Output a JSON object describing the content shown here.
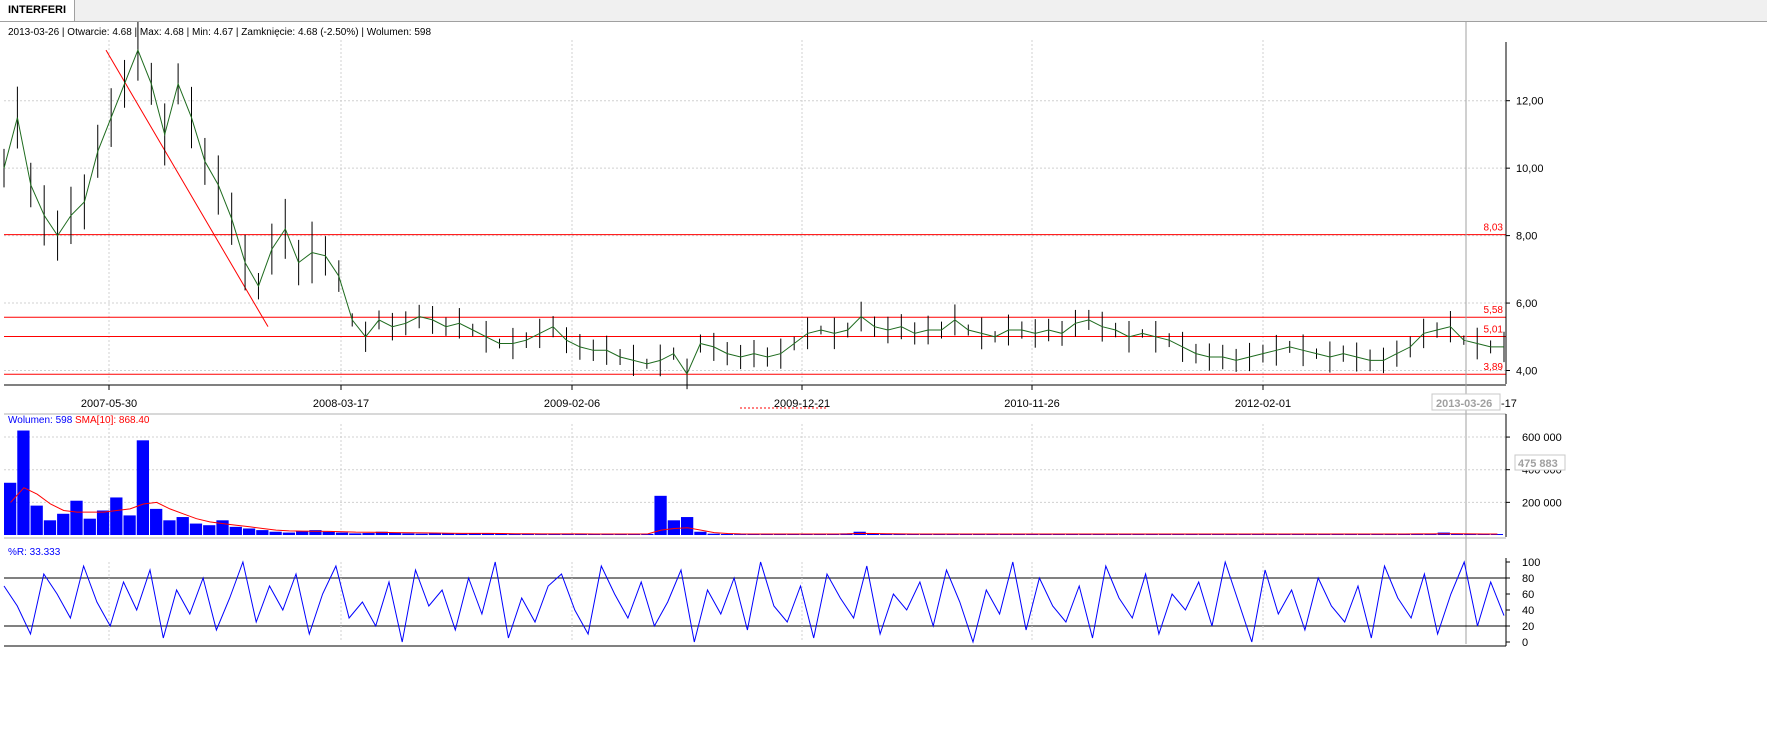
{
  "window": {
    "tab_label": "INTERFERI"
  },
  "price_info": "2013-03-26 | Otwarcie: 4.68 | Max: 4.68 | Min: 4.67 | Zamknięcie: 4.68 (-2.50%)  | Wolumen: 598",
  "volume_info": {
    "label": "Wolumen: 598",
    "sma_label": "SMA[10]: 868.40"
  },
  "willr_info": "%R: 33.333",
  "cursor": {
    "date_label": "2013-03-26",
    "volume_label": "475 883",
    "trailing_label": "-17"
  },
  "colors": {
    "price": "#1e6b1e",
    "volume": "#0000ff",
    "sma": "#ff0000",
    "willr": "#0000ff",
    "hline": "#ff0000",
    "trendline": "#ff0000",
    "grid": "#d0d0d0"
  },
  "chart_data": [
    {
      "type": "line",
      "panel": "price",
      "x_ticks": [
        "2007-05-30",
        "2008-03-17",
        "2009-02-06",
        "2009-12-21",
        "2010-11-26",
        "2012-02-01"
      ],
      "y_ticks": [
        "4,00",
        "6,00",
        "8,00",
        "10,00",
        "12,00"
      ],
      "ylim": [
        3.6,
        13.8
      ],
      "series": [
        {
          "values": [
            10.0,
            11.5,
            9.5,
            8.6,
            8.0,
            8.6,
            9.0,
            10.5,
            11.5,
            12.5,
            13.5,
            12.5,
            11.0,
            12.5,
            11.5,
            10.2,
            9.5,
            8.5,
            7.2,
            6.5,
            7.6,
            8.2,
            7.2,
            7.5,
            7.4,
            6.8,
            5.5,
            5.0,
            5.5,
            5.3,
            5.4,
            5.6,
            5.5,
            5.3,
            5.4,
            5.2,
            5.0,
            4.8,
            4.8,
            4.9,
            5.1,
            5.3,
            4.9,
            4.7,
            4.6,
            4.6,
            4.4,
            4.3,
            4.2,
            4.3,
            4.5,
            3.9,
            4.8,
            4.7,
            4.5,
            4.4,
            4.5,
            4.4,
            4.5,
            4.8,
            5.1,
            5.2,
            5.1,
            5.2,
            5.6,
            5.3,
            5.2,
            5.3,
            5.1,
            5.2,
            5.2,
            5.5,
            5.2,
            5.1,
            5.0,
            5.2,
            5.2,
            5.1,
            5.2,
            5.1,
            5.4,
            5.5,
            5.3,
            5.2,
            5.0,
            5.1,
            5.0,
            4.9,
            4.7,
            4.5,
            4.4,
            4.4,
            4.3,
            4.4,
            4.5,
            4.6,
            4.7,
            4.6,
            4.5,
            4.4,
            4.5,
            4.4,
            4.3,
            4.3,
            4.5,
            4.7,
            5.1,
            5.2,
            5.3,
            4.9,
            4.8,
            4.7,
            4.7
          ]
        }
      ]
    },
    {
      "type": "bar",
      "panel": "volume",
      "y_ticks": [
        "200 000",
        "400 000",
        "600 000"
      ],
      "ylim": [
        0,
        680000
      ],
      "series": [
        {
          "name": "Wolumen",
          "values": [
            320000,
            640000,
            180000,
            90000,
            130000,
            210000,
            100000,
            150000,
            230000,
            120000,
            580000,
            160000,
            90000,
            110000,
            70000,
            60000,
            90000,
            50000,
            40000,
            30000,
            20000,
            15000,
            25000,
            30000,
            20000,
            15000,
            10000,
            12000,
            20000,
            15000,
            10000,
            8000,
            12000,
            10000,
            8000,
            10000,
            12000,
            8000,
            6000,
            7000,
            5000,
            6000,
            8000,
            7000,
            6000,
            5000,
            6000,
            8000,
            7000,
            240000,
            90000,
            110000,
            20000,
            8000,
            6000,
            5000,
            6000,
            7000,
            5000,
            8000,
            6000,
            7000,
            6000,
            10000,
            20000,
            9000,
            7000,
            6000,
            5000,
            6000,
            5000,
            8000,
            6000,
            5000,
            6000,
            7000,
            5000,
            6000,
            5000,
            6000,
            7000,
            5000,
            6000,
            5000,
            6000,
            5000,
            7000,
            6000,
            5000,
            6000,
            5000,
            6000,
            5000,
            6000,
            7000,
            6000,
            5000,
            6000,
            5000,
            6000,
            7000,
            6000,
            5000,
            6000,
            5000,
            7000,
            8000,
            6000,
            15000,
            7000,
            6000,
            5000,
            6000
          ]
        },
        {
          "name": "SMA[10]",
          "values": [
            200000,
            290000,
            250000,
            190000,
            150000,
            140000,
            140000,
            140000,
            150000,
            160000,
            190000,
            200000,
            160000,
            130000,
            100000,
            80000,
            70000,
            60000,
            50000,
            40000,
            30000,
            25000,
            24000,
            23000,
            22000,
            20000,
            18000,
            17000,
            16000,
            15000,
            14000,
            13000,
            12000,
            11000,
            10000,
            10000,
            10000,
            9000,
            8000,
            8000,
            7000,
            7000,
            7000,
            7000,
            6000,
            6000,
            6000,
            6000,
            7000,
            30000,
            40000,
            45000,
            30000,
            15000,
            9000,
            7000,
            6000,
            6000,
            6000,
            6000,
            6000,
            6000,
            6000,
            7000,
            10000,
            9000,
            8000,
            7000,
            6000,
            6000,
            6000,
            6000,
            6000,
            6000,
            6000,
            6000,
            6000,
            6000,
            6000,
            6000,
            6000,
            6000,
            6000,
            6000,
            6000,
            6000,
            6000,
            6000,
            6000,
            6000,
            6000,
            6000,
            6000,
            6000,
            6000,
            6000,
            6000,
            6000,
            6000,
            6000,
            6000,
            6000,
            6000,
            6000,
            6000,
            6000,
            7000,
            7000,
            8000,
            8000,
            7000,
            6000,
            6000
          ]
        }
      ]
    },
    {
      "type": "line",
      "panel": "willr",
      "y_ticks": [
        "0",
        "20",
        "40",
        "60",
        "80",
        "100"
      ],
      "ylim": [
        0,
        100
      ],
      "series": [
        {
          "name": "%R",
          "values": [
            70,
            45,
            10,
            85,
            60,
            30,
            95,
            50,
            20,
            75,
            40,
            90,
            5,
            65,
            35,
            80,
            15,
            55,
            100,
            25,
            70,
            40,
            85,
            10,
            60,
            95,
            30,
            50,
            20,
            75,
            0,
            90,
            45,
            65,
            15,
            80,
            35,
            100,
            5,
            55,
            25,
            70,
            85,
            40,
            10,
            95,
            60,
            30,
            75,
            20,
            50,
            90,
            0,
            65,
            35,
            80,
            15,
            100,
            45,
            25,
            70,
            5,
            85,
            55,
            30,
            95,
            10,
            60,
            40,
            75,
            20,
            90,
            50,
            0,
            65,
            35,
            100,
            15,
            80,
            45,
            25,
            70,
            5,
            95,
            55,
            30,
            85,
            10,
            60,
            40,
            75,
            20,
            100,
            50,
            0,
            90,
            35,
            65,
            15,
            80,
            45,
            25,
            70,
            5,
            95,
            55,
            30,
            85,
            10,
            60,
            100,
            20,
            75,
            33
          ]
        }
      ]
    }
  ],
  "hlines": [
    {
      "label": "8,03",
      "value": 8.03
    },
    {
      "label": "5,58",
      "value": 5.58
    },
    {
      "label": "5,01",
      "value": 5.01
    },
    {
      "label": "3,89",
      "value": 3.89
    }
  ],
  "trendline": {
    "from": [
      "2007-05-30",
      13.5
    ],
    "to": [
      "2007-12-15",
      5.3
    ]
  }
}
